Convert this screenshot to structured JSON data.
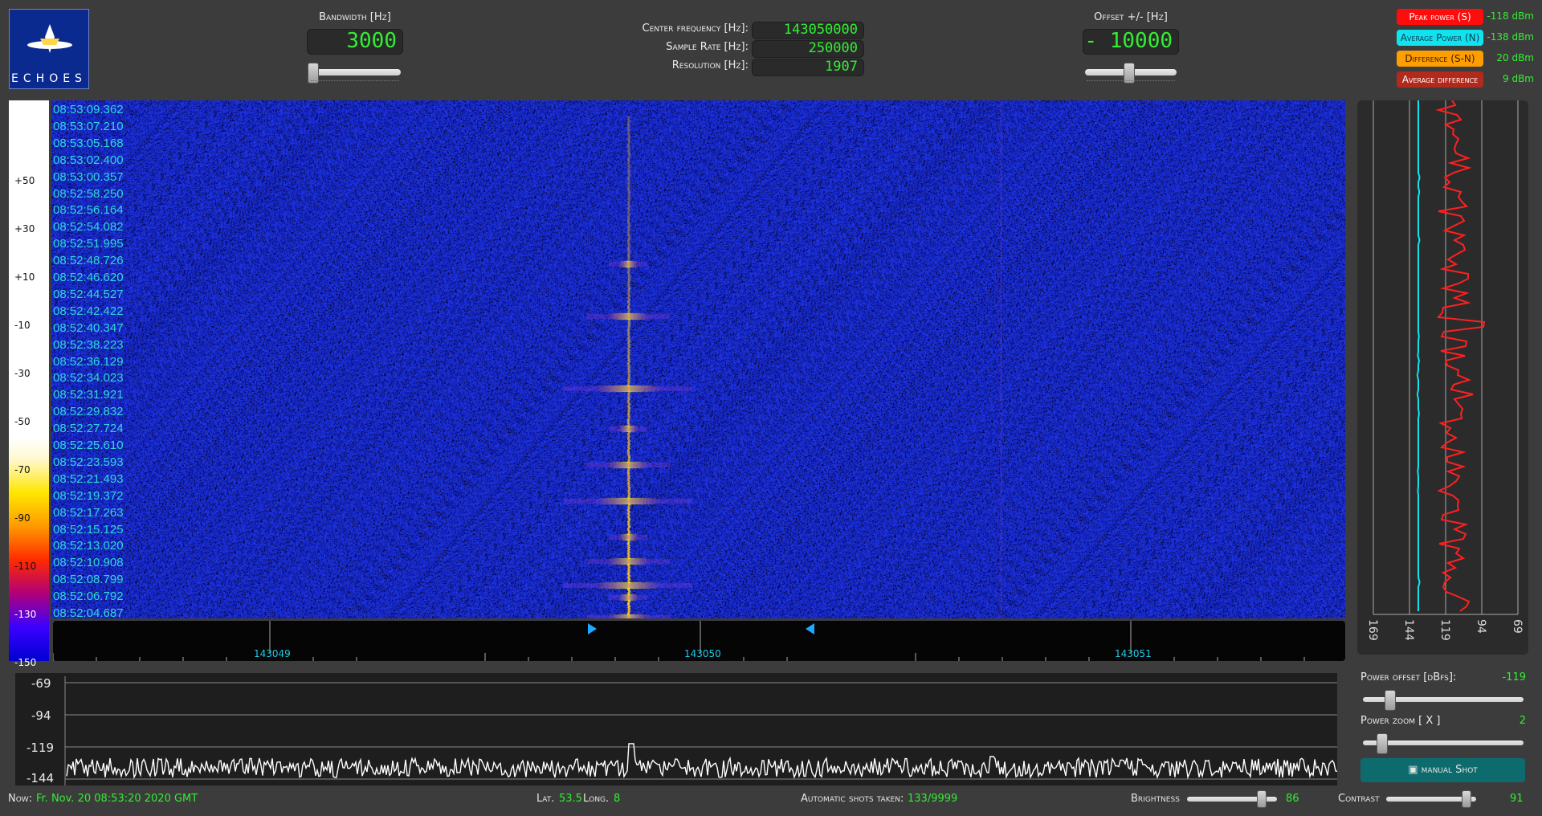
{
  "logo": {
    "text": "ECHOES"
  },
  "bandwidth": {
    "label": "Bandwidth [Hz]",
    "value": "3000"
  },
  "center": {
    "center_label": "Center frequency [Hz]:",
    "center_value": "143050000",
    "sample_label": "Sample Rate [Hz]:",
    "sample_value": "250000",
    "resolution_label": "Resolution [Hz]:",
    "resolution_value": "1907"
  },
  "offset": {
    "label": "Offset +/- [Hz]",
    "value": "- 10000"
  },
  "legend": [
    {
      "label": "Peak power (S)",
      "value": "-118 dBm",
      "color": "#ff0d0d"
    },
    {
      "label": "Average Power (N)",
      "value": "-138 dBm",
      "color": "#11e3ee"
    },
    {
      "label": "Difference (S-N)",
      "value": "20 dBm",
      "color": "#ff9e00"
    },
    {
      "label": "Average difference",
      "value": "9 dBm",
      "color": "#b22a1c"
    }
  ],
  "colorbar_ticks": [
    "+50",
    "+30",
    "+10",
    "-10",
    "-30",
    "-50",
    "-70",
    "-90",
    "-110",
    "-130",
    "-150"
  ],
  "timestamps": [
    "08:53:09.362",
    "08:53:07.210",
    "08:53:05.168",
    "08:53:02.400",
    "08:53:00.357",
    "08:52:58.250",
    "08:52:56.164",
    "08:52:54.082",
    "08:52:51.995",
    "08:52:48.726",
    "08:52:46.620",
    "08:52:44.527",
    "08:52:42.422",
    "08:52:40.347",
    "08:52:38.223",
    "08:52:36.129",
    "08:52:34.023",
    "08:52:31.921",
    "08:52:29.832",
    "08:52:27.724",
    "08:52:25.610",
    "08:52:23.593",
    "08:52:21.493",
    "08:52:19.372",
    "08:52:17.263",
    "08:52:15.125",
    "08:52:13.020",
    "08:52:10.908",
    "08:52:08.799",
    "08:52:06.792",
    "08:52:04.687"
  ],
  "freq_axis": {
    "labels": [
      "143049",
      "143050",
      "143051"
    ]
  },
  "power_graph": {
    "axis_labels": [
      "169",
      "144",
      "119",
      "94",
      "69"
    ]
  },
  "scope": {
    "y_labels": [
      "-69",
      "-94",
      "-119",
      "-144"
    ]
  },
  "controls": {
    "power_offset_label": "Power offset [dBfs]:",
    "power_offset_value": "-119",
    "power_zoom_label": "Power zoom  [ X ]",
    "power_zoom_value": "2",
    "manual_shot_label": "manual Shot"
  },
  "status": {
    "now_label": "Now:",
    "now_value": "Fr. Nov. 20 08:53:20 2020 GMT",
    "lat_label": "Lat.",
    "lat_value": "53.5",
    "long_label": "Long.",
    "long_value": "8",
    "shots_label": "Automatic shots taken:",
    "shots_value": "133/9999",
    "brightness_label": "Brightness",
    "brightness_value": "86",
    "contrast_label": "Contrast",
    "contrast_value": "91"
  }
}
